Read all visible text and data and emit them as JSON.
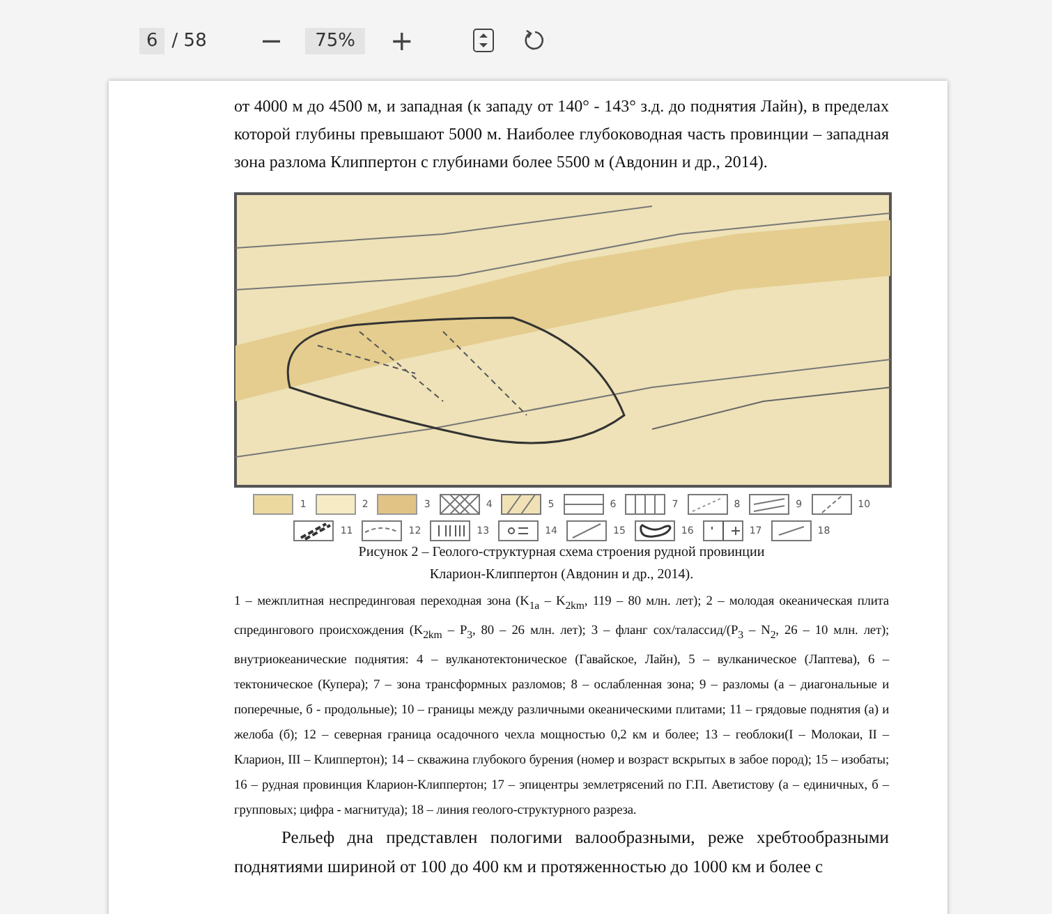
{
  "toolbar": {
    "page": "6",
    "page_total": "/ 58",
    "zoom_out": "−",
    "zoom": "75%",
    "zoom_in": "+"
  },
  "paragraph_top": "от 4000 м до 4500 м, и западная (к западу от 140° - 143° з.д. до поднятия Лайн), в пределах которой глубины превышают 5000 м. Наиболее глубоководная часть провинции – западная зона разлома Клиппертон с глубинами более 5500 м (Авдонин и др., 2014).",
  "legend": [
    {
      "label": "1"
    },
    {
      "label": "2"
    },
    {
      "label": "3"
    },
    {
      "label": "4"
    },
    {
      "label": "5"
    },
    {
      "label": "6"
    },
    {
      "label": "7"
    },
    {
      "label": "8"
    },
    {
      "label": "9"
    },
    {
      "label": "10"
    },
    {
      "label": "11"
    },
    {
      "label": "12"
    },
    {
      "label": "13"
    },
    {
      "label": "14"
    },
    {
      "label": "15"
    },
    {
      "label": "16"
    },
    {
      "label": "17"
    },
    {
      "label": "18"
    }
  ],
  "caption": [
    "Рисунок 2 – Геолого-структурная схема строения рудной провинции",
    "Кларион-Клиппертон  (Авдонин и др., 2014)."
  ],
  "legend_text": "1 – межплитная неспрединговая переходная зона (K$_{1a}$ – K$_{2km}$, 119 – 80 млн. лет); 2 – молодая океаническая плита спредингового происхождения (K$_{2km}$ – P$_{3}$, 80 – 26 млн. лет); 3 – фланг сох/талассид/(P$_{3}$ – N$_{2}$, 26 – 10 млн. лет); внутриокеанические поднятия: 4 – вулканотектоническое (Гавайское, Лайн), 5 – вулканическое (Лаптева), 6 – тектоническое (Купера); 7 – зона трансформных разломов; 8 – ослабленная зона; 9 – разломы (а – диагональные и поперечные, б - продольные); 10 – границы между различными океаническими плитами; 11 – грядовые поднятия (а) и желоба (б); 12 – северная граница осадочного чехла мощностью 0,2 км и более; 13 – геоблоки(I – Молокаи, II – Кларион, III – Клиппертон); 14 – скважина глубокого бурения (номер и возраст вскрытых в забое пород); 15 – изобаты; 16 – рудная провинция Кларион-Клиппертон; 17 – эпицентры землетрясений по Г.П. Аветистову (а – единичных, б – групповых; цифра - магнитуда); 18 – линия геолого-структурного разреза.",
  "paragraph_bottom": "Рельеф дна представлен пологими валообразными, реже хребтообразными поднятиями шириной от 100 до 400 км и протяженностью до 1000 км и более с"
}
